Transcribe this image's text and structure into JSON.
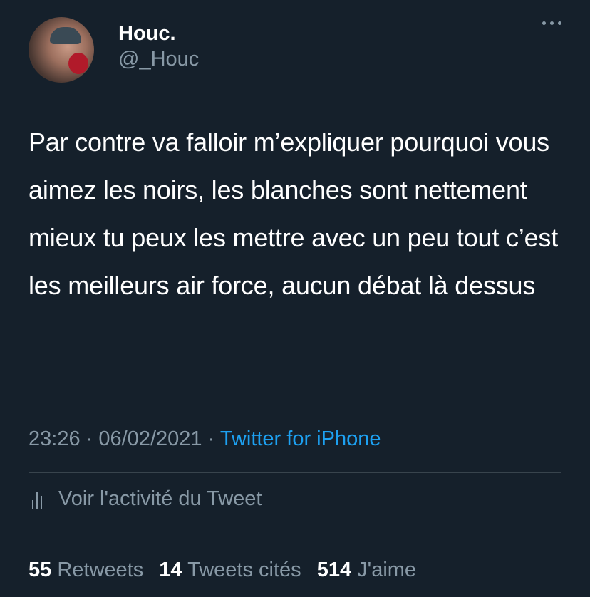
{
  "tweet": {
    "author": {
      "display_name": "Houc.",
      "handle": "@_Houc"
    },
    "text": "Par contre va falloir m’expliquer pourquoi vous aimez les noirs, les blanches sont nettement mieux tu peux les mettre avec un peu tout c’est les meilleurs air force, aucun débat là dessus",
    "time": "23:26",
    "separator": "·",
    "date": "06/02/2021",
    "source": "Twitter for iPhone",
    "activity_label": "Voir l'activité du Tweet",
    "stats": {
      "retweets_count": "55",
      "retweets_label": "Retweets",
      "quotes_count": "14",
      "quotes_label": "Tweets cités",
      "likes_count": "514",
      "likes_label": "J'aime"
    }
  },
  "icons": {
    "more": "more-horizontal-icon",
    "activity": "bar-chart-icon"
  },
  "colors": {
    "background": "#15202b",
    "primary_text": "#ffffff",
    "secondary_text": "#8899a6",
    "accent": "#1da1f2",
    "divider": "#38444d"
  }
}
